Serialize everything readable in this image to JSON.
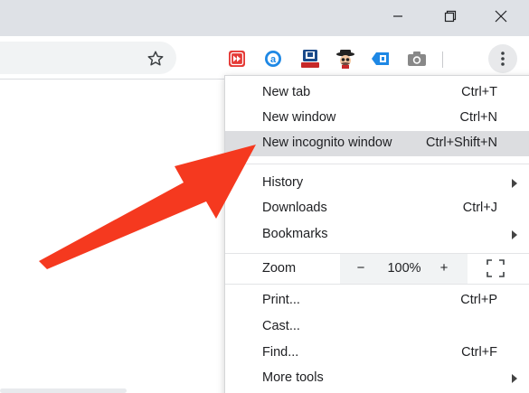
{
  "window_controls": {
    "minimize_icon": "minimize-icon",
    "maximize_icon": "restore-icon",
    "close_icon": "close-icon"
  },
  "toolbar": {
    "bookmark_icon": "star-icon",
    "extensions": [
      {
        "name": "fast-forward-extension-icon",
        "color": "#e53935"
      },
      {
        "name": "at-sign-extension-icon",
        "color": "#1e88e5"
      },
      {
        "name": "bookmark-extension-icon",
        "color": "#1a4a8a"
      },
      {
        "name": "spy-hat-extension-icon",
        "color": "#6d4c41"
      },
      {
        "name": "tag-extension-icon",
        "color": "#1e88e5"
      },
      {
        "name": "camera-extension-icon",
        "color": "#888888"
      }
    ],
    "menu_icon": "three-dots-icon"
  },
  "menu": {
    "new_tab": {
      "label": "New tab",
      "shortcut": "Ctrl+T"
    },
    "new_window": {
      "label": "New window",
      "shortcut": "Ctrl+N"
    },
    "new_incognito": {
      "label": "New incognito window",
      "shortcut": "Ctrl+Shift+N"
    },
    "history": {
      "label": "History"
    },
    "downloads": {
      "label": "Downloads",
      "shortcut": "Ctrl+J"
    },
    "bookmarks": {
      "label": "Bookmarks"
    },
    "zoom": {
      "label": "Zoom",
      "minus": "−",
      "value": "100%",
      "plus": "+"
    },
    "print": {
      "label": "Print...",
      "shortcut": "Ctrl+P"
    },
    "cast": {
      "label": "Cast..."
    },
    "find": {
      "label": "Find...",
      "shortcut": "Ctrl+F"
    },
    "more_tools": {
      "label": "More tools"
    }
  },
  "colors": {
    "annotation_arrow": "#f5391f",
    "highlight": "#dcdde0",
    "titlebar": "#dee1e6"
  }
}
